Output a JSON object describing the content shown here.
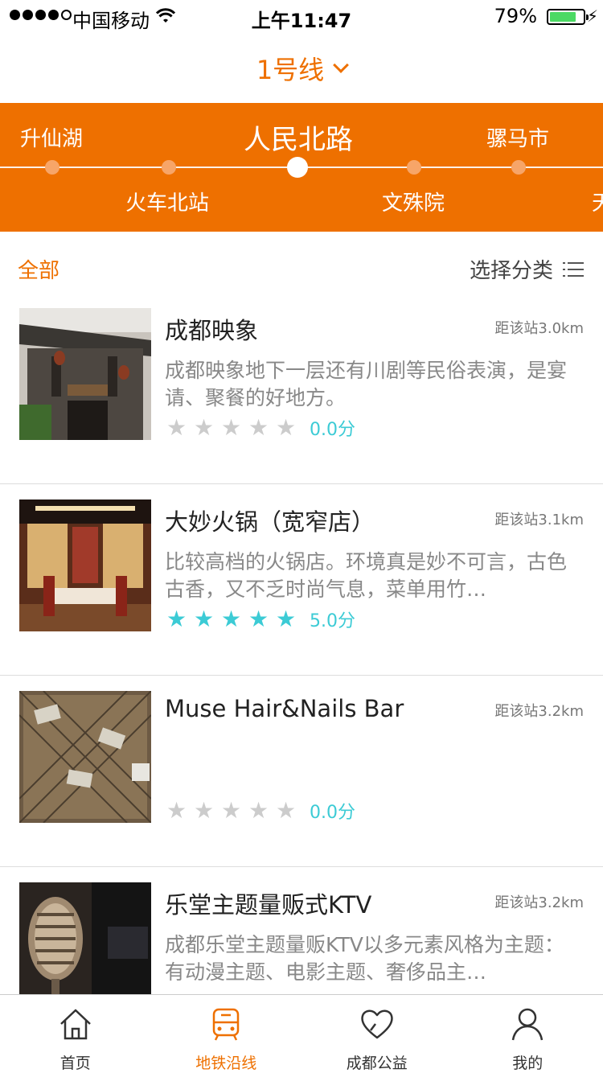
{
  "status_bar": {
    "carrier": "中国移动",
    "time": "上午11:47",
    "battery": "79%",
    "battery_level": 0.79
  },
  "header": {
    "line_label": "1号线",
    "dropdown_icon": "chevron-down-icon"
  },
  "stations": {
    "top_row": [
      "升仙湖",
      "人民北路",
      "骡马市"
    ],
    "bottom_row": [
      "火车北站",
      "文殊院",
      "天"
    ],
    "current": "人民北路"
  },
  "filter": {
    "all_label": "全部",
    "category_label": "选择分类",
    "category_icon": "list-icon"
  },
  "places": [
    {
      "name": "成都映象",
      "distance": "距该站3.0km",
      "description": "成都映象地下一层还有川剧等民俗表演，是宴请、聚餐的好地方。",
      "stars": 0,
      "score": "0.0分"
    },
    {
      "name": "大妙火锅（宽窄店）",
      "distance": "距该站3.1km",
      "description": "比较高档的火锅店。环境真是妙不可言，古色古香，又不乏时尚气息，菜单用竹…",
      "stars": 5,
      "score": "5.0分"
    },
    {
      "name": "Muse Hair&Nails Bar",
      "distance": "距该站3.2km",
      "description": "",
      "stars": 0,
      "score": "0.0分"
    },
    {
      "name": "乐堂主题量贩式KTV",
      "distance": "距该站3.2km",
      "description": "成都乐堂主题量贩KTV以多元素风格为主题：有动漫主题、电影主题、奢侈品主…",
      "stars": 0,
      "score": ""
    }
  ],
  "tabbar": [
    {
      "label": "首页",
      "icon": "home-icon",
      "active": false
    },
    {
      "label": "地铁沿线",
      "icon": "bus-icon",
      "active": true
    },
    {
      "label": "成都公益",
      "icon": "heart-icon",
      "active": false
    },
    {
      "label": "我的",
      "icon": "user-icon",
      "active": false
    }
  ],
  "colors": {
    "accent": "#ee7000",
    "rating": "#3ccbd5",
    "battery": "#4cd964"
  }
}
